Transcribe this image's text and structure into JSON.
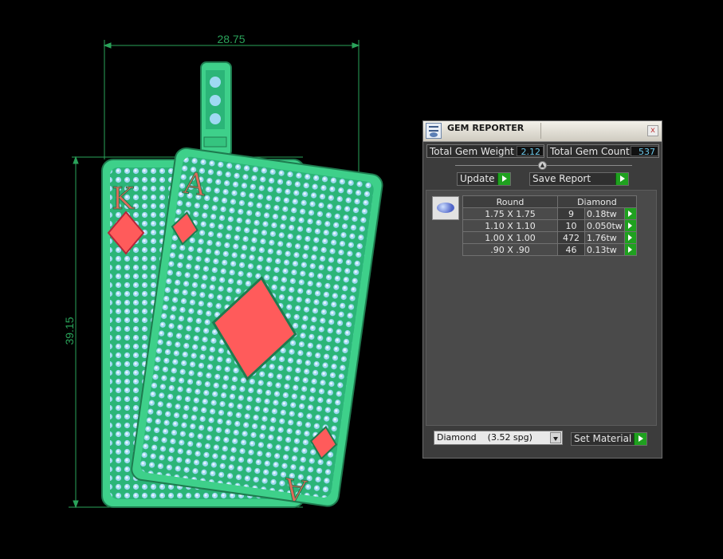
{
  "viewport": {
    "dimensions": {
      "width": "28.75",
      "height": "39.15"
    },
    "colors": {
      "dimension_line": "#2aa35a",
      "metal": "#3ed08a",
      "gem_accent": "#ff5b5b"
    },
    "cards": [
      {
        "rank": "K",
        "suit": "diamond"
      },
      {
        "rank": "A",
        "suit": "diamond"
      }
    ]
  },
  "gem_reporter": {
    "title": "GEM REPORTER",
    "close": "x",
    "total_weight_label": "Total Gem Weight",
    "total_weight_value": "2.12",
    "total_count_label": "Total Gem Count",
    "total_count_value": "537",
    "update_label": "Update",
    "save_report_label": "Save Report",
    "table": {
      "headers": [
        "Round",
        "Diamond"
      ],
      "rows": [
        {
          "size": "1.75 X 1.75",
          "count": "9",
          "weight": "0.18tw"
        },
        {
          "size": "1.10 X 1.10",
          "count": "10",
          "weight": "0.050tw"
        },
        {
          "size": "1.00 X 1.00",
          "count": "472",
          "weight": "1.76tw"
        },
        {
          "size": ".90 X .90",
          "count": "46",
          "weight": "0.13tw"
        }
      ]
    },
    "material_value": "Diamond    (3.52 spg)",
    "set_material_label": "Set Material",
    "icons": [
      "app-icon",
      "collapse-icon",
      "gem-icon",
      "go-arrow-icon",
      "dropdown-arrow-icon"
    ]
  }
}
